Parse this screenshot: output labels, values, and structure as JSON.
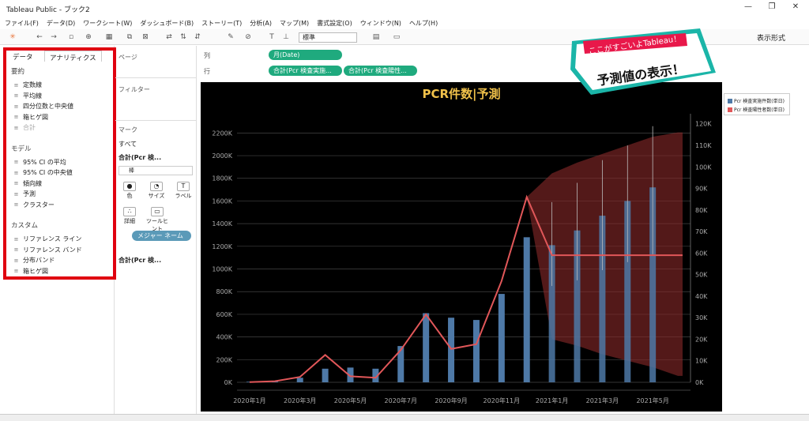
{
  "window": {
    "title": "Tableau Public - ブック2",
    "min": "—",
    "max": "❐",
    "close": "✕"
  },
  "menu": [
    "ファイル(F)",
    "データ(D)",
    "ワークシート(W)",
    "ダッシュボード(B)",
    "ストーリー(T)",
    "分析(A)",
    "マップ(M)",
    "書式設定(O)",
    "ウィンドウ(N)",
    "ヘルプ(H)"
  ],
  "toolbar": {
    "fit_value": "標準",
    "show_me": "表示形式"
  },
  "left_tabs": {
    "data": "データ",
    "analytics": "アナリティクス"
  },
  "analytics": {
    "summary_title": "要約",
    "summary": [
      {
        "label": "定数線",
        "icon": "constant-line-icon"
      },
      {
        "label": "平均線",
        "icon": "average-line-icon"
      },
      {
        "label": "四分位数と中央値",
        "icon": "quartile-icon"
      },
      {
        "label": "箱ヒゲ図",
        "icon": "box-plot-icon"
      },
      {
        "label": "合計",
        "icon": "totals-icon"
      }
    ],
    "model_title": "モデル",
    "model": [
      {
        "label": "95% CI の平均",
        "icon": "ci-mean-icon"
      },
      {
        "label": "95% CI の中央値",
        "icon": "ci-median-icon"
      },
      {
        "label": "傾向線",
        "icon": "trend-line-icon"
      },
      {
        "label": "予測",
        "icon": "forecast-icon"
      },
      {
        "label": "クラスター",
        "icon": "cluster-icon"
      }
    ],
    "custom_title": "カスタム",
    "custom": [
      {
        "label": "リファレンス ライン",
        "icon": "reference-line-icon"
      },
      {
        "label": "リファレンス バンド",
        "icon": "reference-band-icon"
      },
      {
        "label": "分布バンド",
        "icon": "distribution-band-icon"
      },
      {
        "label": "箱ヒゲ図",
        "icon": "box-plot-icon"
      }
    ]
  },
  "pages_label": "ページ",
  "filters_label": "フィルター",
  "marks": {
    "title": "マーク",
    "all": "すべて",
    "card1": "合計(Pcr 検...",
    "type": "棒",
    "color": "色",
    "size": "サイズ",
    "label": "ラベル",
    "detail": "詳細",
    "tooltip": "ツールヒント",
    "measure_names": "メジャー ネーム",
    "card2": "合計(Pcr 検..."
  },
  "shelves": {
    "columns_label": "列",
    "rows_label": "行",
    "col_pill": "月(Date)",
    "row_pill1": "合計(Pcr 検査実施...",
    "row_pill2": "合計(Pcr 検査陽性..."
  },
  "callout": {
    "line1": "ここがすごいよTableau！",
    "line2": "予測値の表示！"
  },
  "chart_data": {
    "type": "bar",
    "title": "PCR件数|予測",
    "x_tick_labels": [
      "2020年1月",
      "2020年3月",
      "2020年5月",
      "2020年7月",
      "2020年9月",
      "2020年11月",
      "2021年1月",
      "2021年3月",
      "2021年5月"
    ],
    "categories": [
      "2020-01",
      "2020-02",
      "2020-03",
      "2020-04",
      "2020-05",
      "2020-06",
      "2020-07",
      "2020-08",
      "2020-09",
      "2020-10",
      "2020-11",
      "2020-12",
      "2021-01",
      "2021-02",
      "2021-03",
      "2021-04",
      "2021-05",
      "2021-06"
    ],
    "left_axis": {
      "ticks": [
        "0K",
        "200K",
        "400K",
        "600K",
        "800K",
        "1000K",
        "1200K",
        "1400K",
        "1600K",
        "1800K",
        "2000K",
        "2200K"
      ],
      "ylim": [
        0,
        2300
      ]
    },
    "right_axis": {
      "ticks": [
        "0K",
        "10K",
        "20K",
        "30K",
        "40K",
        "50K",
        "60K",
        "70K",
        "80K",
        "90K",
        "100K",
        "110K",
        "120K"
      ],
      "ylim": [
        0,
        121
      ]
    },
    "series": [
      {
        "name": "Pcr 検査実施件数(単日)",
        "axis": "left",
        "color": "#4e79a7",
        "values": [
          5,
          10,
          40,
          120,
          130,
          120,
          320,
          610,
          570,
          550,
          780,
          1280,
          1210,
          1340,
          1470,
          1600,
          1720,
          null
        ],
        "forecast_from": 12,
        "error_low": [
          null,
          null,
          null,
          null,
          null,
          null,
          null,
          null,
          null,
          null,
          null,
          null,
          850,
          900,
          990,
          1060,
          1130,
          null
        ],
        "error_high": [
          null,
          null,
          null,
          null,
          null,
          null,
          null,
          null,
          null,
          null,
          null,
          null,
          1590,
          1760,
          1960,
          2090,
          2260,
          null
        ]
      },
      {
        "name": "Pcr 検査陽性者数(単日)",
        "axis": "right",
        "color": "#e15759",
        "values": [
          0.1,
          0.5,
          2.5,
          12.7,
          2.8,
          2.1,
          15,
          31.5,
          15.5,
          17.7,
          47,
          86,
          59,
          59,
          59,
          59,
          59,
          59
        ],
        "forecast_from": 12,
        "band_low": [
          null,
          null,
          null,
          null,
          null,
          null,
          null,
          null,
          null,
          null,
          null,
          86,
          20,
          17,
          13,
          10,
          7,
          3
        ],
        "band_high": [
          null,
          null,
          null,
          null,
          null,
          null,
          null,
          null,
          null,
          null,
          null,
          86,
          97,
          102,
          106,
          110,
          114,
          116
        ]
      }
    ],
    "grid": true,
    "legend": "right"
  }
}
